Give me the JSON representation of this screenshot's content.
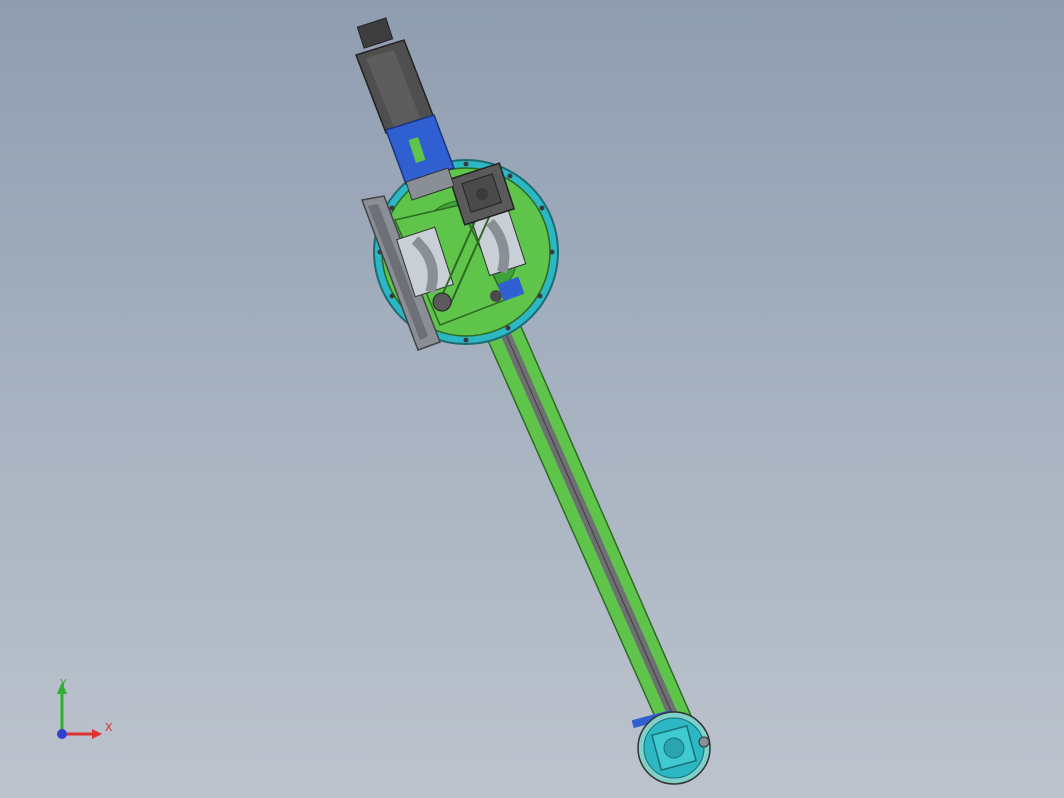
{
  "viewport": {
    "background_top": "#8f9db0",
    "background_bottom": "#bcc3cd"
  },
  "model": {
    "name_hint": "robot-arm-assembly",
    "colors": {
      "plate_green": "#5ec44a",
      "plate_dark_green": "#2f8a2a",
      "motor_gray": "#5a5a5a",
      "motor_dark": "#3a3a3a",
      "gearbox_blue": "#2f5fd0",
      "base_cyan": "#2bb8c4",
      "bracket_gray": "#8a8f96",
      "rail_gray": "#6d6f72"
    }
  },
  "triad": {
    "x_label": "X",
    "y_label": "Y",
    "x_color": "#e03030",
    "y_color": "#30b030",
    "z_color": "#3040d0"
  }
}
